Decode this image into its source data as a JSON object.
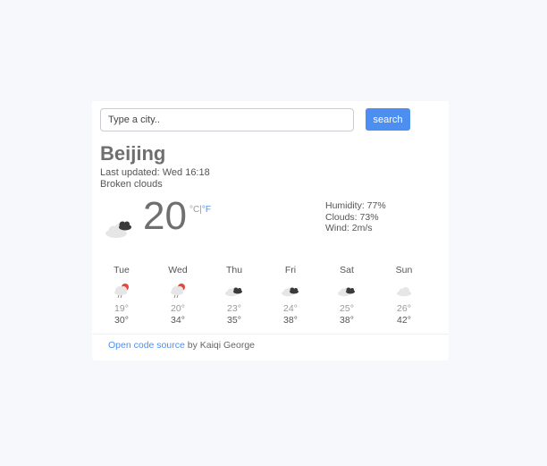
{
  "search": {
    "placeholder": "Type a city..",
    "button_label": "search"
  },
  "current": {
    "city": "Beijing",
    "last_updated": "Last updated: Wed 16:18",
    "description": "Broken clouds",
    "temperature": "20",
    "unit_celsius": "°C",
    "unit_separator": "|",
    "unit_fahrenheit": "°F",
    "icon": "broken-clouds-icon",
    "humidity": "Humidity: 77%",
    "clouds": "Clouds: 73%",
    "wind": "Wind: 2m/s"
  },
  "forecast": [
    {
      "day": "Tue",
      "icon": "light-rain-sun-icon",
      "low": "19°",
      "high": "30°"
    },
    {
      "day": "Wed",
      "icon": "light-rain-sun-icon",
      "low": "20°",
      "high": "34°"
    },
    {
      "day": "Thu",
      "icon": "broken-clouds-icon",
      "low": "23°",
      "high": "35°"
    },
    {
      "day": "Fri",
      "icon": "broken-clouds-icon",
      "low": "24°",
      "high": "38°"
    },
    {
      "day": "Sat",
      "icon": "broken-clouds-icon",
      "low": "25°",
      "high": "38°"
    },
    {
      "day": "Sun",
      "icon": "cloud-icon",
      "low": "26°",
      "high": "42°"
    }
  ],
  "footer": {
    "link_text": "Open code source",
    "author_text": " by Kaiqi George"
  },
  "colors": {
    "accent": "#4c8ff0",
    "background": "#f7f8fb",
    "card": "#ffffff"
  }
}
